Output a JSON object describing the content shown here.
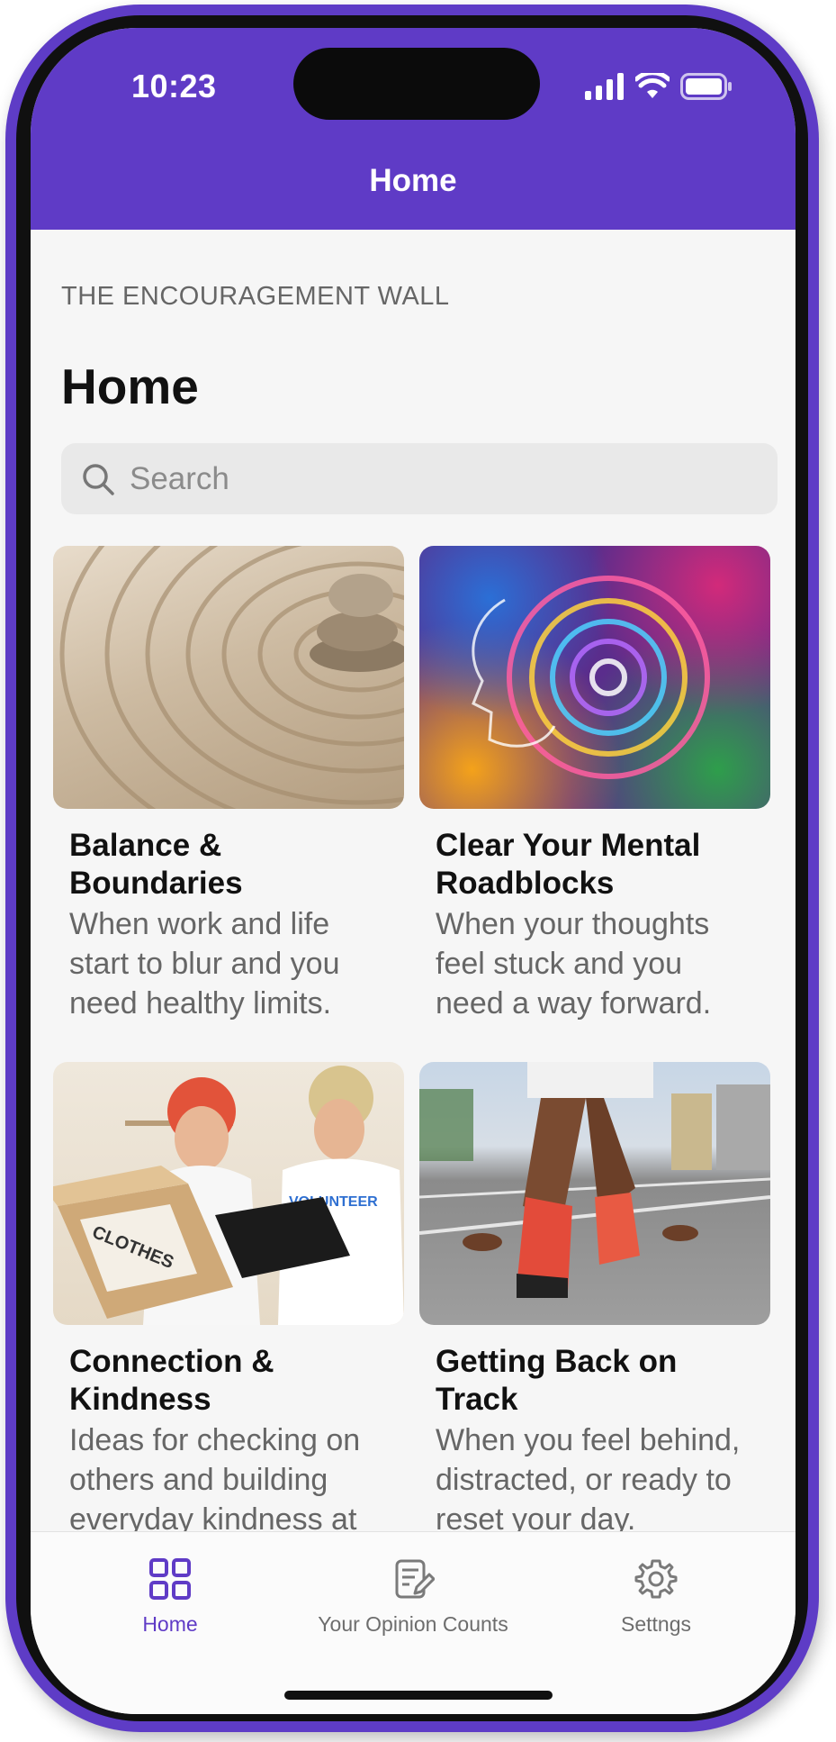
{
  "status_bar": {
    "time": "10:23"
  },
  "nav_bar": {
    "title": "Home"
  },
  "eyebrow": "THE ENCOURAGEMENT WALL",
  "page_title": "Home",
  "search": {
    "placeholder": "Search"
  },
  "cards": [
    {
      "title": "Balance & Boundaries",
      "description": "When work and life start to blur and you need healthy limits."
    },
    {
      "title": "Clear Your Mental Roadblocks",
      "description": "When your thoughts feel stuck and you need a way forward."
    },
    {
      "title": "Connection & Kindness",
      "description": "Ideas for checking on others and building everyday kindness at work."
    },
    {
      "title": "Getting Back on Track",
      "description": "When you feel behind, distracted, or ready to reset your day."
    }
  ],
  "tabs": [
    {
      "label": "Home",
      "icon": "grid-icon"
    },
    {
      "label": "Your Opinion Counts",
      "icon": "edit-note-icon"
    },
    {
      "label": "Settngs",
      "icon": "gear-icon"
    }
  ],
  "colors": {
    "accent": "#5f3bc6",
    "background": "#f6f6f6"
  }
}
